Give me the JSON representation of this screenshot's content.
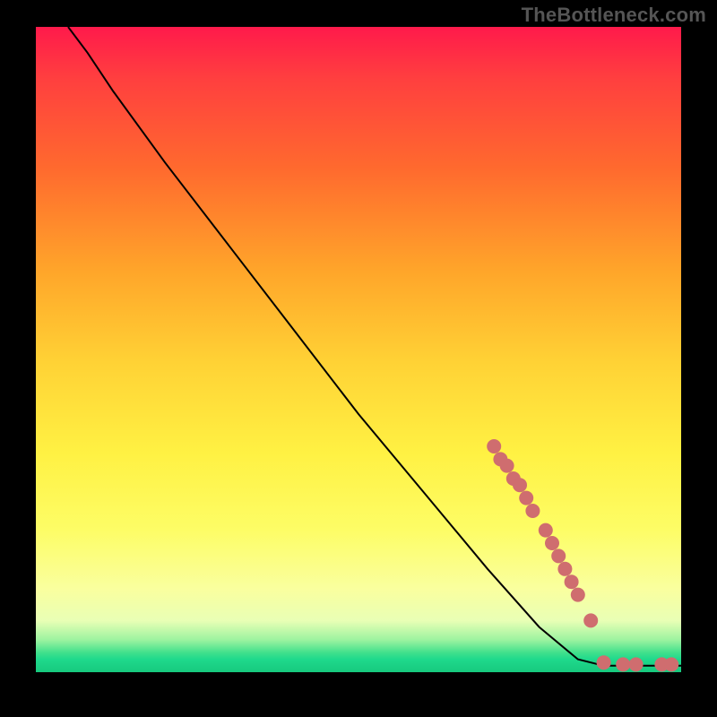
{
  "attribution": "TheBottleneck.com",
  "colors": {
    "dot": "#cf6d6f",
    "curve": "#000000",
    "frame": "#000000"
  },
  "chart_data": {
    "type": "line",
    "title": "",
    "xlabel": "",
    "ylabel": "",
    "xlim": [
      0,
      100
    ],
    "ylim": [
      0,
      100
    ],
    "grid": false,
    "legend": false,
    "curve": [
      {
        "x": 5,
        "y": 100
      },
      {
        "x": 8,
        "y": 96
      },
      {
        "x": 12,
        "y": 90
      },
      {
        "x": 20,
        "y": 79
      },
      {
        "x": 30,
        "y": 66
      },
      {
        "x": 40,
        "y": 53
      },
      {
        "x": 50,
        "y": 40
      },
      {
        "x": 60,
        "y": 28
      },
      {
        "x": 70,
        "y": 16
      },
      {
        "x": 78,
        "y": 7
      },
      {
        "x": 84,
        "y": 2
      },
      {
        "x": 88,
        "y": 1
      },
      {
        "x": 100,
        "y": 1
      }
    ],
    "points": [
      {
        "x": 71,
        "y": 35
      },
      {
        "x": 72,
        "y": 33
      },
      {
        "x": 73,
        "y": 32
      },
      {
        "x": 74,
        "y": 30
      },
      {
        "x": 75,
        "y": 29
      },
      {
        "x": 76,
        "y": 27
      },
      {
        "x": 77,
        "y": 25
      },
      {
        "x": 79,
        "y": 22
      },
      {
        "x": 80,
        "y": 20
      },
      {
        "x": 81,
        "y": 18
      },
      {
        "x": 82,
        "y": 16
      },
      {
        "x": 83,
        "y": 14
      },
      {
        "x": 84,
        "y": 12
      },
      {
        "x": 86,
        "y": 8
      },
      {
        "x": 88,
        "y": 1.5
      },
      {
        "x": 91,
        "y": 1.2
      },
      {
        "x": 93,
        "y": 1.2
      },
      {
        "x": 97,
        "y": 1.2
      },
      {
        "x": 98.5,
        "y": 1.2
      }
    ]
  }
}
